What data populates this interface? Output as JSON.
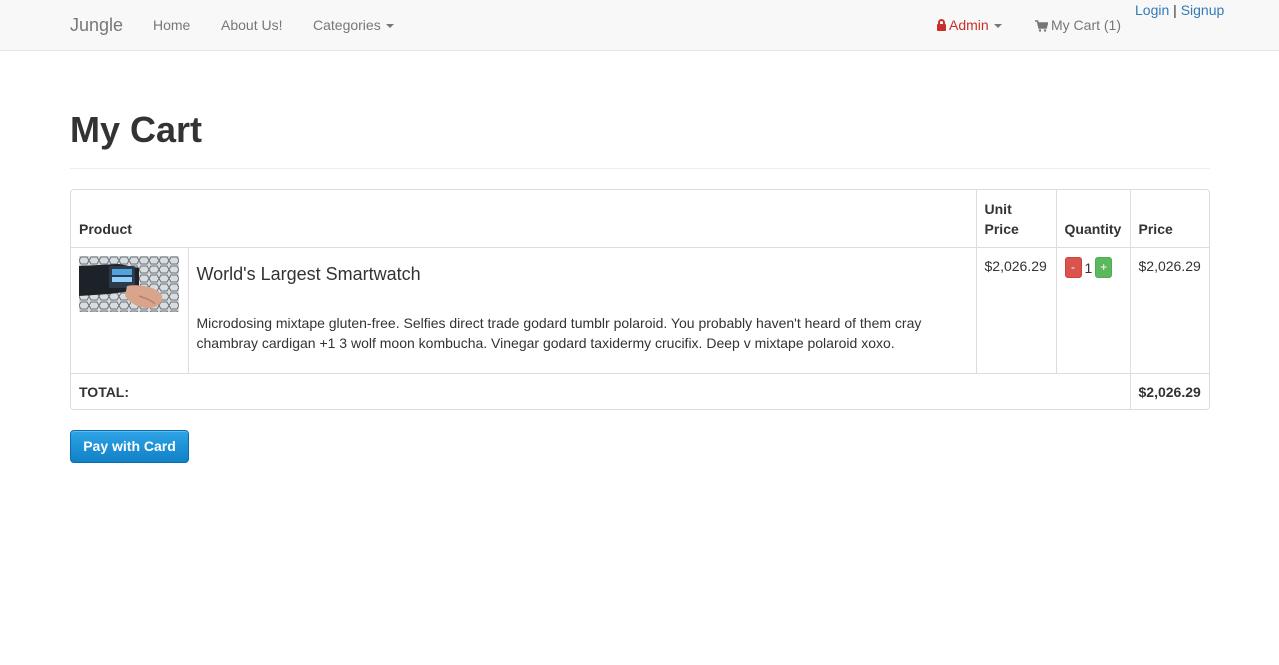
{
  "navbar": {
    "brand": "Jungle",
    "home": "Home",
    "about": "About Us!",
    "categories": "Categories",
    "admin": "Admin",
    "cart": "My Cart (1)",
    "login": "Login",
    "separator": "|",
    "signup": "Signup"
  },
  "page": {
    "title": "My Cart"
  },
  "table": {
    "headers": {
      "product": "Product",
      "unit_price": "Unit Price",
      "quantity": "Quantity",
      "price": "Price"
    },
    "items": [
      {
        "name": "World's Largest Smartwatch",
        "description": "Microdosing mixtape gluten-free. Selfies direct trade godard tumblr polaroid. You probably haven't heard of them cray chambray cardigan +1 3 wolf moon kombucha. Vinegar godard taxidermy crucifix. Deep v mixtape polaroid xoxo.",
        "unit_price": "$2,026.29",
        "quantity": "1",
        "minus": "-",
        "plus": "+",
        "price": "$2,026.29"
      }
    ],
    "total_label": "TOTAL:",
    "total_value": "$2,026.29"
  },
  "actions": {
    "pay_label": "Pay with Card"
  },
  "colors": {
    "link": "#337ab7",
    "admin": "#c9302c",
    "pay_button": "#1a8fd8"
  }
}
